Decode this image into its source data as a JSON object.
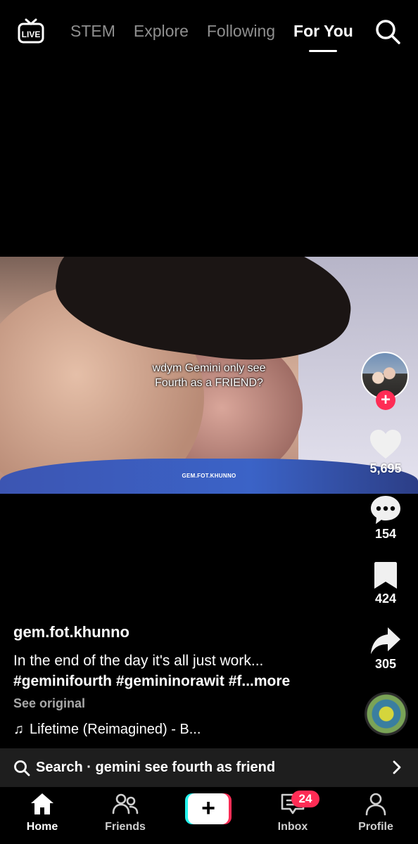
{
  "top_nav": {
    "live_label": "LIVE",
    "tabs": [
      {
        "label": "STEM",
        "active": false
      },
      {
        "label": "Explore",
        "active": false
      },
      {
        "label": "Following",
        "active": false
      },
      {
        "label": "For You",
        "active": true
      }
    ],
    "search_icon": "search-icon"
  },
  "video": {
    "caption_line1": "wdym Gemini only see",
    "caption_line2": "Fourth as a FRIEND?",
    "watermark": "GEM.FOT.KHUNNO"
  },
  "actions": {
    "like_count": "5,695",
    "comment_count": "154",
    "save_count": "424",
    "share_count": "305",
    "follow_symbol": "+"
  },
  "post": {
    "username": "gem.fot.khunno",
    "description": "In the end of the day it's all just work...",
    "hashtags": "#geminifourth #gemininorawit #f",
    "more_label": "...more",
    "see_original": "See original",
    "music": "Lifetime (Reimagined) - B..."
  },
  "search_suggestion": {
    "text": "Search · gemini see fourth as friend"
  },
  "bottom_nav": {
    "home": "Home",
    "friends": "Friends",
    "create_symbol": "+",
    "inbox": "Inbox",
    "inbox_badge": "24",
    "profile": "Profile"
  },
  "colors": {
    "accent": "#fe2c55",
    "cyan": "#25f4ee",
    "background": "#000000"
  }
}
